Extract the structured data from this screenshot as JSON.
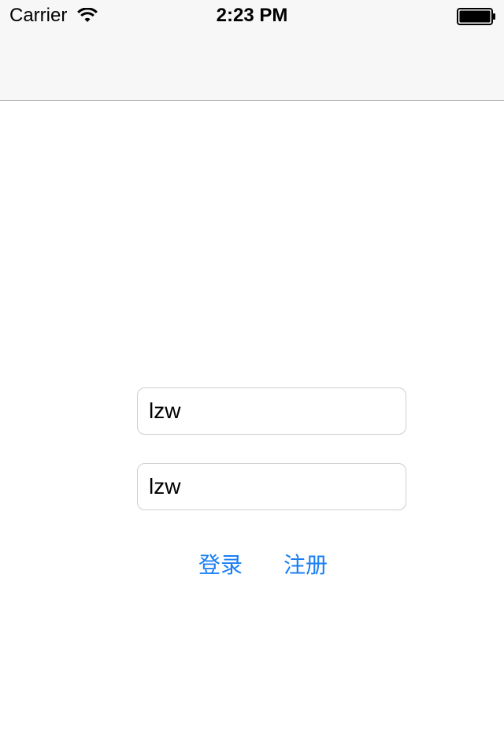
{
  "status_bar": {
    "carrier": "Carrier",
    "time": "2:23 PM",
    "wifi_icon": "wifi-icon",
    "battery_icon": "battery-icon"
  },
  "form": {
    "username_value": "lzw",
    "password_value": "lzw"
  },
  "buttons": {
    "login_label": "登录",
    "register_label": "注册"
  },
  "colors": {
    "accent": "#1a7ef5",
    "nav_background": "#f7f7f7",
    "field_border": "#cfcfcf"
  }
}
